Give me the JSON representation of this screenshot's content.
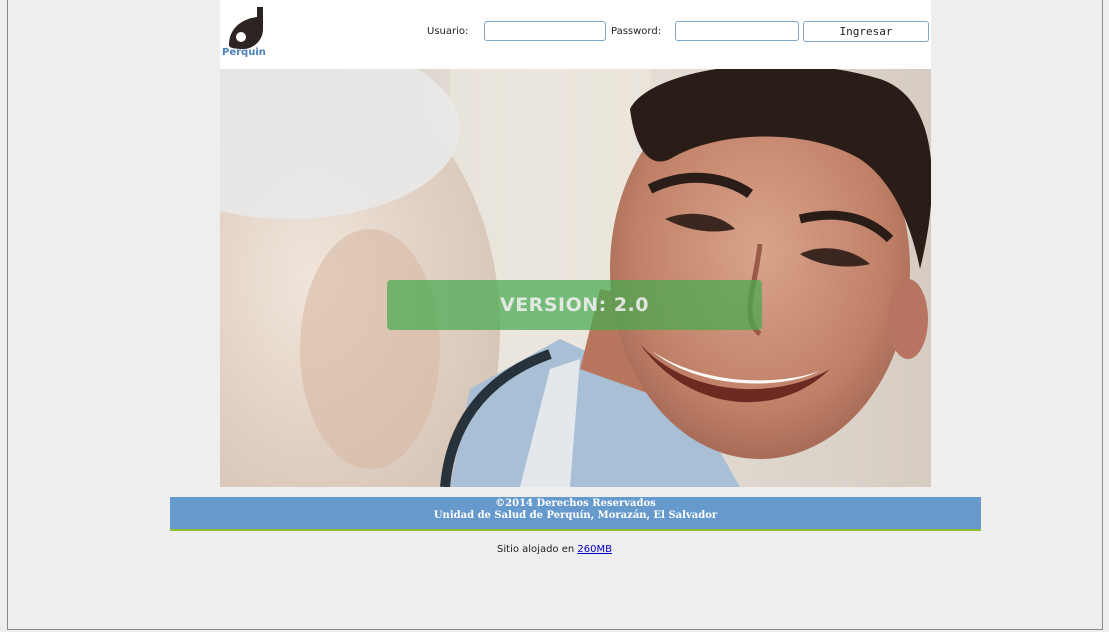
{
  "header": {
    "logo_text": "Perquin",
    "usuario_label": "Usuario:",
    "password_label": "Password:",
    "usuario_value": "",
    "password_value": "",
    "login_button": "Ingresar"
  },
  "hero": {
    "version_text": "VERSION: 2.0",
    "overlay_color": "#46aa50"
  },
  "footer": {
    "line1": "©2014 Derechos Reservados",
    "line2": "Unidad de Salud de Perquín, Morazán, El Salvador",
    "background_color": "#6699cc"
  },
  "hosting": {
    "prefix": "Sitio alojado en",
    "link_text": "260MB"
  }
}
